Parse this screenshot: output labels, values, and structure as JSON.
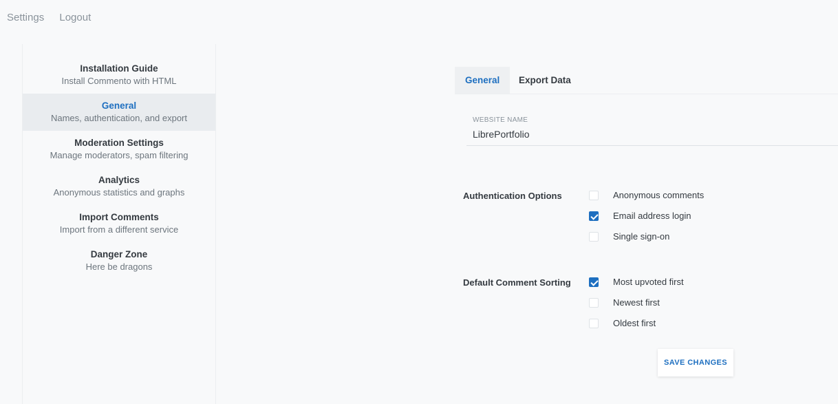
{
  "topnav": {
    "settings": "Settings",
    "logout": "Logout"
  },
  "sidebar": {
    "items": [
      {
        "title": "Installation Guide",
        "desc": "Install Commento with HTML"
      },
      {
        "title": "General",
        "desc": "Names, authentication, and export",
        "active": true
      },
      {
        "title": "Moderation Settings",
        "desc": "Manage moderators, spam filtering"
      },
      {
        "title": "Analytics",
        "desc": "Anonymous statistics and graphs"
      },
      {
        "title": "Import Comments",
        "desc": "Import from a different service"
      },
      {
        "title": "Danger Zone",
        "desc": "Here be dragons"
      }
    ]
  },
  "tabs": {
    "general": "General",
    "export": "Export Data"
  },
  "website_name": {
    "label": "WEBSITE NAME",
    "value": "LibrePortfolio"
  },
  "auth": {
    "label": "Authentication Options",
    "options": [
      {
        "label": "Anonymous comments",
        "checked": false
      },
      {
        "label": "Email address login",
        "checked": true
      },
      {
        "label": "Single sign-on",
        "checked": false
      }
    ]
  },
  "sorting": {
    "label": "Default Comment Sorting",
    "options": [
      {
        "label": "Most upvoted first",
        "checked": true
      },
      {
        "label": "Newest first",
        "checked": false
      },
      {
        "label": "Oldest first",
        "checked": false
      }
    ]
  },
  "save_label": "SAVE CHANGES",
  "colors": {
    "accent": "#1e6fc0",
    "active_bg": "#e9ecef",
    "page_bg": "#f8f9fa"
  }
}
